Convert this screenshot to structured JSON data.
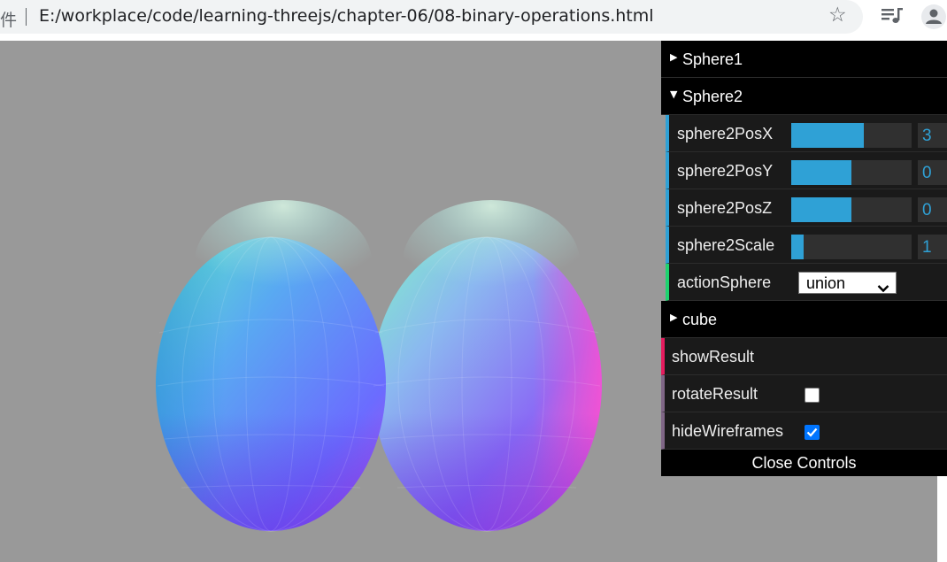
{
  "browser": {
    "scheme_fragment": "件",
    "url": "E:/workplace/code/learning-threejs/chapter-06/08-binary-operations.html",
    "icons": [
      "bookmark-star-icon",
      "media-queue-icon",
      "profile-icon"
    ]
  },
  "scene": {
    "background_color": "#999999",
    "object": "sphere-union-mesh"
  },
  "gui": {
    "folders": [
      {
        "label": "Sphere1",
        "expanded": false
      },
      {
        "label": "Sphere2",
        "expanded": true
      },
      {
        "label": "cube",
        "expanded": false
      }
    ],
    "sphere2": {
      "posx": {
        "label": "sphere2PosX",
        "value": "3",
        "fraction": 0.6
      },
      "posy": {
        "label": "sphere2PosY",
        "value": "0",
        "fraction": 0.5
      },
      "posz": {
        "label": "sphere2PosZ",
        "value": "0",
        "fraction": 0.5
      },
      "scale": {
        "label": "sphere2Scale",
        "value": "1",
        "fraction": 0.1
      },
      "action": {
        "label": "actionSphere",
        "value": "union"
      }
    },
    "show_result": {
      "label": "showResult"
    },
    "rotate_result": {
      "label": "rotateResult",
      "checked": false
    },
    "hide_wireframes": {
      "label": "hideWireframes",
      "checked": true
    },
    "close_label": "Close Controls",
    "accent_colors": {
      "number": "#2fa1d6",
      "option": "#1ed36f",
      "function": "#e61d5f",
      "boolean": "#806787"
    }
  },
  "highlight": {
    "target": "actionSphere-select",
    "color": "#e53935"
  }
}
